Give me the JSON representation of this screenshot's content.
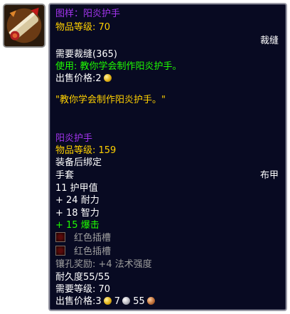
{
  "recipe": {
    "name": "图样：阳炎护手",
    "item_level": "物品等级: 70",
    "profession_type": "裁缝",
    "requires": "需要裁缝(365)",
    "use_text": "使用: 教你学会制作阳炎护手。",
    "sell_price_label": "出售价格:2",
    "flavor": "\"教你学会制作阳炎护手。\""
  },
  "crafted_item": {
    "name": "阳炎护手",
    "item_level": "物品等级: 159",
    "bind": "装备后绑定",
    "slot": "手套",
    "armor_type": "布甲",
    "armor": "11 护甲值",
    "stats": [
      "+ 24 耐力",
      "+ 18 智力"
    ],
    "green_stat": "+ 15 爆击",
    "sockets": [
      "红色插槽",
      "红色插槽"
    ],
    "socket_bonus": "镶孔奖励: +4 法术强度",
    "durability": "耐久度55/55",
    "required_level": "需要等级: 70",
    "sell_price_label": "出售价格:3",
    "sell_silver": "7",
    "sell_copper": "55"
  },
  "icons": {
    "recipe_icon": "pattern-scroll-icon",
    "gold": "gold-coin-icon",
    "silver": "silver-coin-icon",
    "copper": "copper-coin-icon",
    "socket": "red-socket-icon"
  },
  "colors": {
    "epic": "#a335ee",
    "normal": "#ffffff",
    "label": "#ffd100",
    "uncommon": "#1eff00",
    "disabled": "#9d9d9d",
    "background": "#080a22"
  }
}
